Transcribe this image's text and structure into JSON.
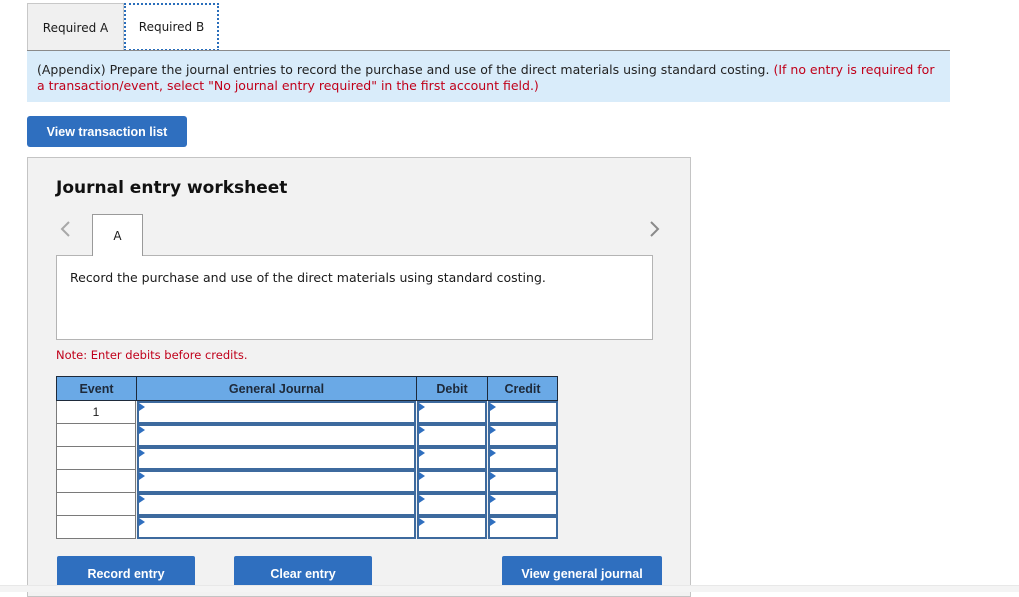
{
  "tabs": [
    {
      "label": "Required A",
      "active": false
    },
    {
      "label": "Required B",
      "active": true
    }
  ],
  "instructions": {
    "main": "(Appendix) Prepare the journal entries to record the purchase and use of the direct materials using standard costing.",
    "hint": "(If no entry is required for a transaction/event, select \"No journal entry required\" in the first account field.)"
  },
  "buttons": {
    "view_transaction_list": "View transaction list",
    "record_entry": "Record entry",
    "clear_entry": "Clear entry",
    "view_general_journal": "View general journal"
  },
  "worksheet": {
    "title": "Journal entry worksheet",
    "prev_icon": "chevron-left-icon",
    "next_icon": "chevron-right-icon",
    "entry_tab": "A",
    "description": "Record the purchase and use of the direct materials using standard costing.",
    "note": "Note: Enter debits before credits.",
    "columns": [
      "Event",
      "General Journal",
      "Debit",
      "Credit"
    ],
    "rows": [
      {
        "event": "1",
        "account": "",
        "debit": "",
        "credit": ""
      },
      {
        "event": "",
        "account": "",
        "debit": "",
        "credit": ""
      },
      {
        "event": "",
        "account": "",
        "debit": "",
        "credit": ""
      },
      {
        "event": "",
        "account": "",
        "debit": "",
        "credit": ""
      },
      {
        "event": "",
        "account": "",
        "debit": "",
        "credit": ""
      },
      {
        "event": "",
        "account": "",
        "debit": "",
        "credit": ""
      }
    ]
  },
  "colors": {
    "button_blue": "#2f6fbf",
    "header_blue": "#6aa9e6",
    "instruction_bg": "#d9ecfa",
    "hint_red": "#c0001a"
  }
}
